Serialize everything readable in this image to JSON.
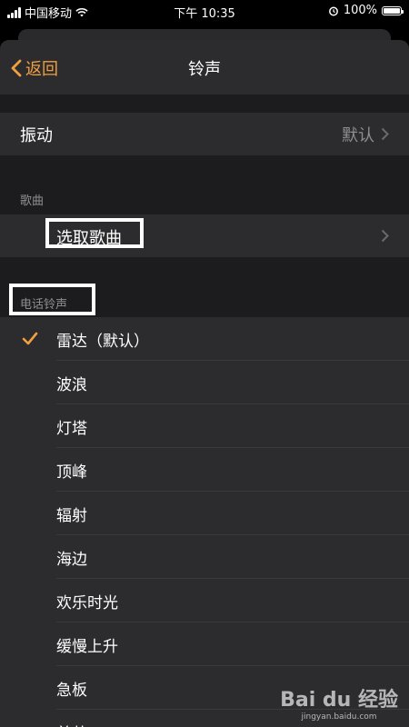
{
  "status_bar": {
    "carrier": "中国移动",
    "time": "下午 10:35",
    "battery": "100%",
    "battery_level": 1.0
  },
  "nav": {
    "back_label": "返回",
    "title": "铃声"
  },
  "vibration": {
    "label": "振动",
    "value": "默认"
  },
  "songs_section": {
    "header": "歌曲",
    "pick_label": "选取歌曲"
  },
  "ringtones_section": {
    "header": "电话铃声",
    "items": [
      {
        "label": "雷达（默认）",
        "selected": true
      },
      {
        "label": "波浪"
      },
      {
        "label": "灯塔"
      },
      {
        "label": "顶峰"
      },
      {
        "label": "辐射"
      },
      {
        "label": "海边"
      },
      {
        "label": "欢乐时光"
      },
      {
        "label": "缓慢上升"
      },
      {
        "label": "急板"
      },
      {
        "label": "煎茶"
      }
    ]
  },
  "watermark": {
    "brand": "Bai du 经验",
    "url": "jingyan.baidu.com"
  },
  "colors": {
    "accent": "#f0a040",
    "sheet_bg": "#1c1c1e",
    "row_bg": "#2c2c2e",
    "secondary_text": "#8e8e93"
  }
}
